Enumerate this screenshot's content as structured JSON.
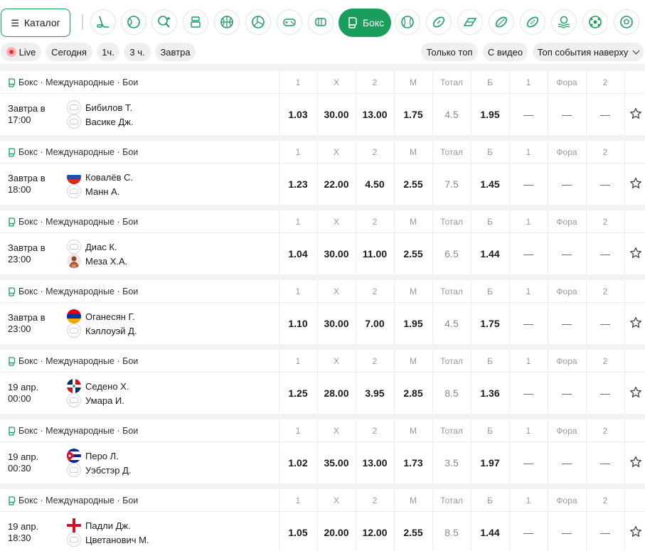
{
  "toolbar": {
    "catalog_label": "Каталог"
  },
  "sports": [
    {
      "icon": "hockey-icon"
    },
    {
      "icon": "tennis-icon"
    },
    {
      "icon": "table-tennis-icon"
    },
    {
      "icon": "esports-icon"
    },
    {
      "icon": "basketball-icon"
    },
    {
      "icon": "volleyball-icon"
    },
    {
      "icon": "gamepad-icon"
    },
    {
      "icon": "mma-icon"
    },
    {
      "icon": "boxing-icon",
      "label": "Бокс",
      "active": true
    },
    {
      "icon": "baseball-icon"
    },
    {
      "icon": "american-football-icon"
    },
    {
      "icon": "racing-icon"
    },
    {
      "icon": "rugby-icon"
    },
    {
      "icon": "rugby-league-icon"
    },
    {
      "icon": "water-polo-icon"
    },
    {
      "icon": "futsal-icon"
    },
    {
      "icon": "football-icon"
    }
  ],
  "filters": {
    "live": "Live",
    "today": "Сегодня",
    "h1": "1ч.",
    "h3": "3 ч.",
    "tomorrow": "Завтра",
    "top_only": "Только топ",
    "with_video": "С видео",
    "sort": "Топ события наверху"
  },
  "columns": [
    "1",
    "X",
    "2",
    "М",
    "Тотал",
    "Б",
    "1",
    "Фора",
    "2"
  ],
  "colors": {
    "accent": "#1a9e5c",
    "live": "#e5323a"
  },
  "events": [
    {
      "league": "Бокс · Международные · Бои",
      "time1": "Завтра в",
      "time2": "17:00",
      "team1": "Бибилов Т.",
      "flag1": "none",
      "team2": "Васике Дж.",
      "flag2": "none",
      "odds": [
        "1.03",
        "30.00",
        "13.00",
        "1.75",
        "4.5",
        "1.95",
        "—",
        "—",
        "—"
      ]
    },
    {
      "league": "Бокс · Международные · Бои",
      "time1": "Завтра в",
      "time2": "18:00",
      "team1": "Ковалёв С.",
      "flag1": "russia",
      "team2": "Манн А.",
      "flag2": "none",
      "odds": [
        "1.23",
        "22.00",
        "4.50",
        "2.55",
        "7.5",
        "1.45",
        "—",
        "—",
        "—"
      ]
    },
    {
      "league": "Бокс · Международные · Бои",
      "time1": "Завтра в",
      "time2": "23:00",
      "team1": "Диас К.",
      "flag1": "none",
      "team2": "Меза Х.А.",
      "flag2": "photo",
      "odds": [
        "1.04",
        "30.00",
        "11.00",
        "2.55",
        "6.5",
        "1.44",
        "—",
        "—",
        "—"
      ]
    },
    {
      "league": "Бокс · Международные · Бои",
      "time1": "Завтра в",
      "time2": "23:00",
      "team1": "Оганесян Г.",
      "flag1": "armenia",
      "team2": "Кэллоуэй Д.",
      "flag2": "none",
      "odds": [
        "1.10",
        "30.00",
        "7.00",
        "1.95",
        "4.5",
        "1.75",
        "—",
        "—",
        "—"
      ]
    },
    {
      "league": "Бокс · Международные · Бои",
      "time1": "19 апр.",
      "time2": "00:00",
      "team1": "Седено Х.",
      "flag1": "dominican",
      "team2": "Умара И.",
      "flag2": "none",
      "odds": [
        "1.25",
        "28.00",
        "3.95",
        "2.85",
        "8.5",
        "1.36",
        "—",
        "—",
        "—"
      ]
    },
    {
      "league": "Бокс · Международные · Бои",
      "time1": "19 апр.",
      "time2": "00:30",
      "team1": "Перо Л.",
      "flag1": "cuba",
      "team2": "Уэбстэр Д.",
      "flag2": "none",
      "odds": [
        "1.02",
        "35.00",
        "13.00",
        "1.73",
        "3.5",
        "1.97",
        "—",
        "—",
        "—"
      ]
    },
    {
      "league": "Бокс · Международные · Бои",
      "time1": "19 апр.",
      "time2": "18:30",
      "team1": "Падли Дж.",
      "flag1": "england",
      "team2": "Цветанович М.",
      "flag2": "none",
      "odds": [
        "1.05",
        "20.00",
        "12.00",
        "2.55",
        "8.5",
        "1.44",
        "—",
        "—",
        "—"
      ]
    }
  ]
}
